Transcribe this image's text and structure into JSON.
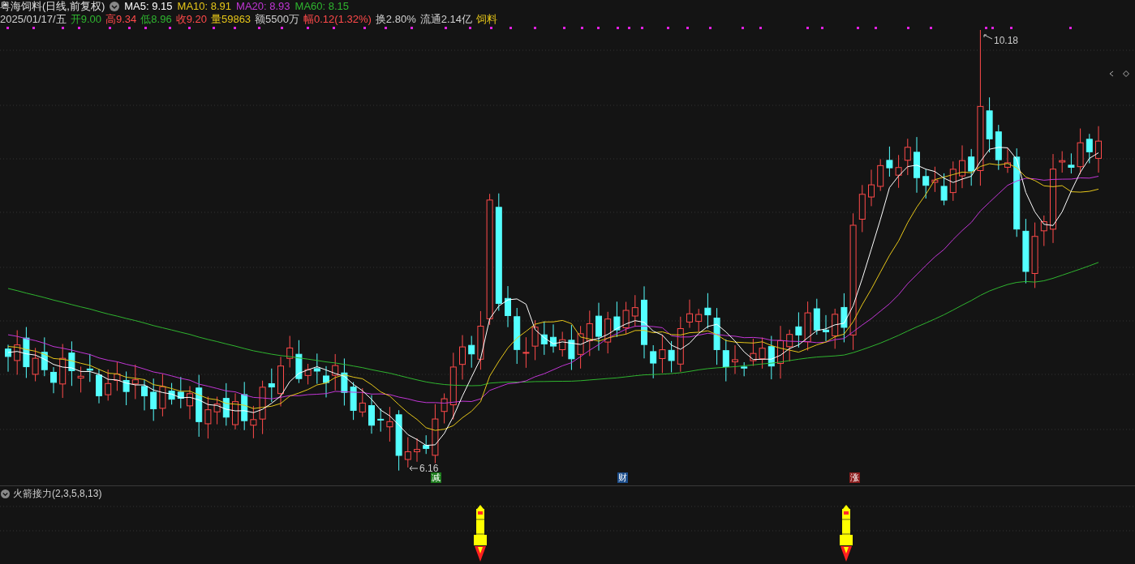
{
  "header": {
    "title": "粤海饲料(日线,前复权)",
    "ma_legend": [
      {
        "label": "MA5: 9.15",
        "color": "#ffffff"
      },
      {
        "label": "MA10: 8.91",
        "color": "#e6c619"
      },
      {
        "label": "MA20: 8.93",
        "color": "#c236d6"
      },
      {
        "label": "MA60: 8.15",
        "color": "#2fb52f"
      }
    ]
  },
  "quote": [
    {
      "text": "2025/01/17/五",
      "color": "#d0d0d0"
    },
    {
      "text": "开9.00",
      "color": "#2fb52f"
    },
    {
      "text": "高9.34",
      "color": "#ff4a4a"
    },
    {
      "text": "低8.96",
      "color": "#2fb52f"
    },
    {
      "text": "收9.20",
      "color": "#ff4a4a"
    },
    {
      "text": "量59863",
      "color": "#e6c619"
    },
    {
      "text": "额5500万",
      "color": "#d0d0d0"
    },
    {
      "text": "幅0.12(1.32%)",
      "color": "#ff4a4a"
    },
    {
      "text": "换2.80%",
      "color": "#d0d0d0"
    },
    {
      "text": "流通2.14亿",
      "color": "#d0d0d0"
    },
    {
      "text": "饲料",
      "color": "#e6c619"
    }
  ],
  "chart": {
    "high_label": "10.18",
    "low_label": "6.16",
    "tags": [
      {
        "text": "减",
        "color": "#1c7a1c"
      },
      {
        "text": "财",
        "color": "#1c4d8a"
      },
      {
        "text": "涨",
        "color": "#8a1c1c"
      }
    ]
  },
  "indicator": {
    "title": "火箭接力(2,3,5,8,13)"
  }
}
